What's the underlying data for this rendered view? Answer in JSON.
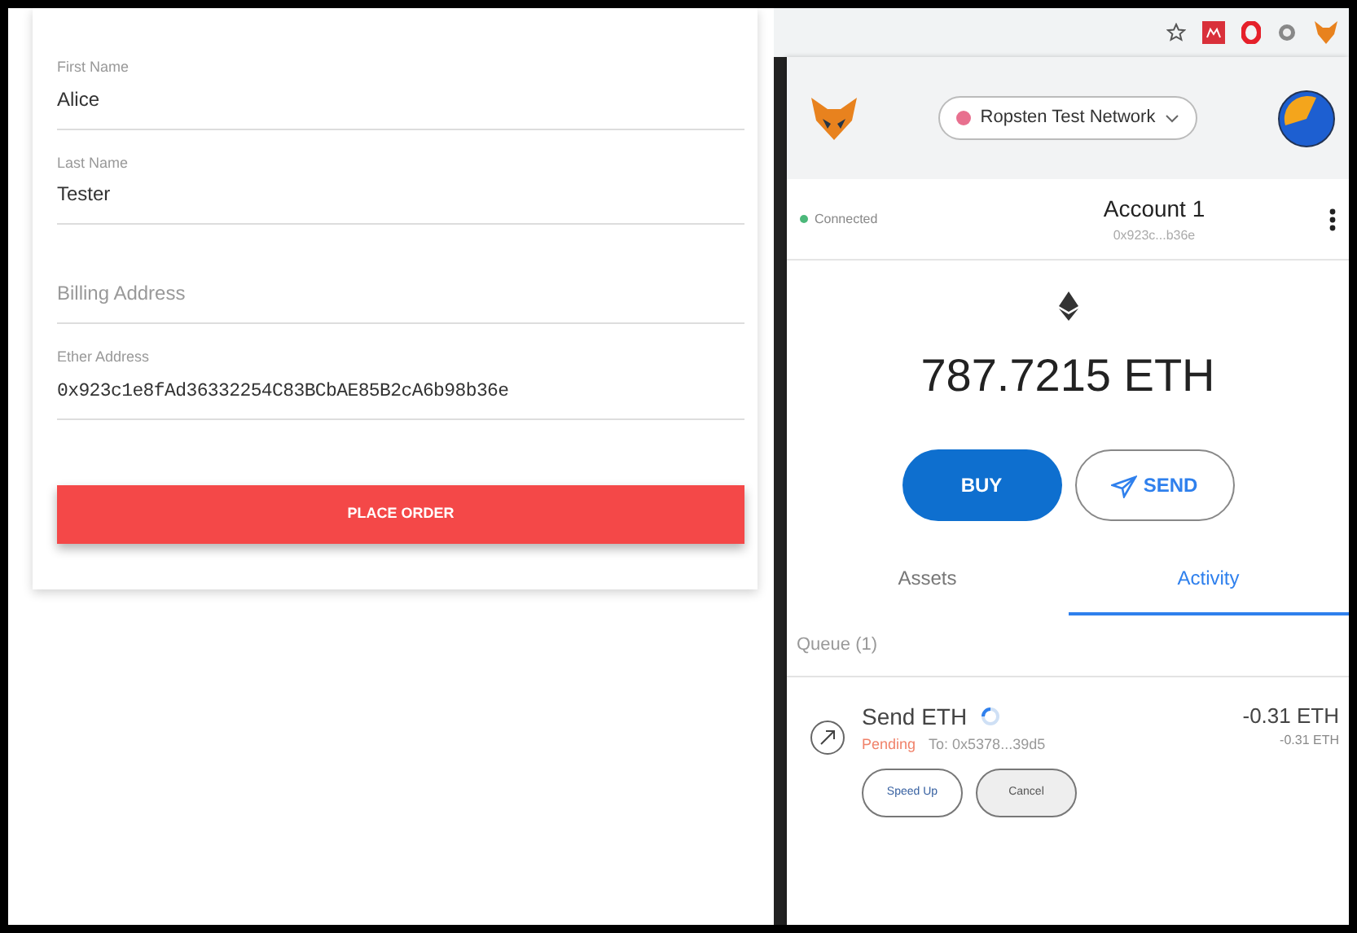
{
  "form": {
    "fields": [
      {
        "label": "First Name",
        "value": "Alice"
      },
      {
        "label": "Last Name",
        "value": "Tester"
      },
      {
        "placeholder": "Billing Address"
      },
      {
        "label": "Ether Address",
        "value": "0x923c1e8fAd36332254C83BCbAE85B2cA6b98b36e"
      }
    ],
    "submit": "PLACE ORDER"
  },
  "wallet": {
    "network": "Ropsten Test Network",
    "connection": "Connected",
    "account": "Account 1",
    "address": "0x923c...b36e",
    "balance": "787.7215",
    "unit": "ETH",
    "actions": [
      "BUY",
      "SEND"
    ],
    "tabs": [
      {
        "label": "Assets",
        "selected": false
      },
      {
        "label": "Activity",
        "selected": true
      }
    ],
    "queue_label": "Queue (1)",
    "transactions": [
      {
        "title": "Send ETH",
        "status": "Pending",
        "to": "To: 0x5378...39d5",
        "amount": "-0.31 ETH",
        "fiat": "-0.31 ETH",
        "buttons": [
          "Speed Up",
          "Cancel"
        ]
      }
    ]
  }
}
